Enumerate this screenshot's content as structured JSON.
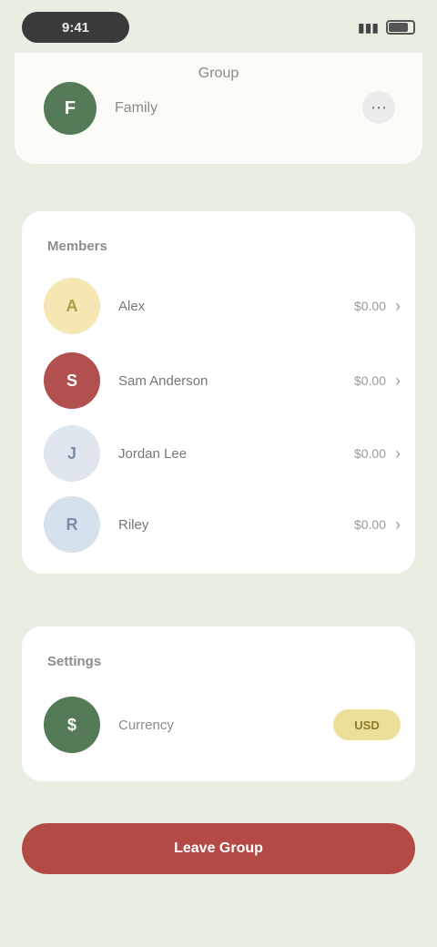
{
  "status_bar": {
    "time": "9:41",
    "battery_level": 0.8
  },
  "header": {
    "title": "Group",
    "avatar_initials": "F",
    "name": "Family",
    "action_icon": "more-icon"
  },
  "members": {
    "title": "Members",
    "items": [
      {
        "initials": "A",
        "name": "Alex",
        "amount": "$0.00",
        "color": "#f5e6b3",
        "text_color": "#b39a4a"
      },
      {
        "initials": "S",
        "name": "Sam Anderson",
        "amount": "$0.00",
        "color": "#b24f4f",
        "text_color": "#ffffff"
      },
      {
        "initials": "J",
        "name": "Jordan Lee",
        "amount": "$0.00",
        "color": "#dfe6ee",
        "text_color": "#7b8da3"
      },
      {
        "initials": "R",
        "name": "Riley",
        "amount": "$0.00",
        "color": "#d6e1ee",
        "text_color": "#7b8da3"
      }
    ]
  },
  "settings": {
    "title": "Settings",
    "label": "Currency",
    "avatar_initials": "$",
    "badge": "USD"
  },
  "cta": {
    "label": "Leave Group"
  },
  "colors": {
    "background": "#e9eee2",
    "card": "#ffffff",
    "accent_green": "#557a58",
    "accent_red": "#b34a45",
    "badge_yellow": "#ecdf9a"
  }
}
